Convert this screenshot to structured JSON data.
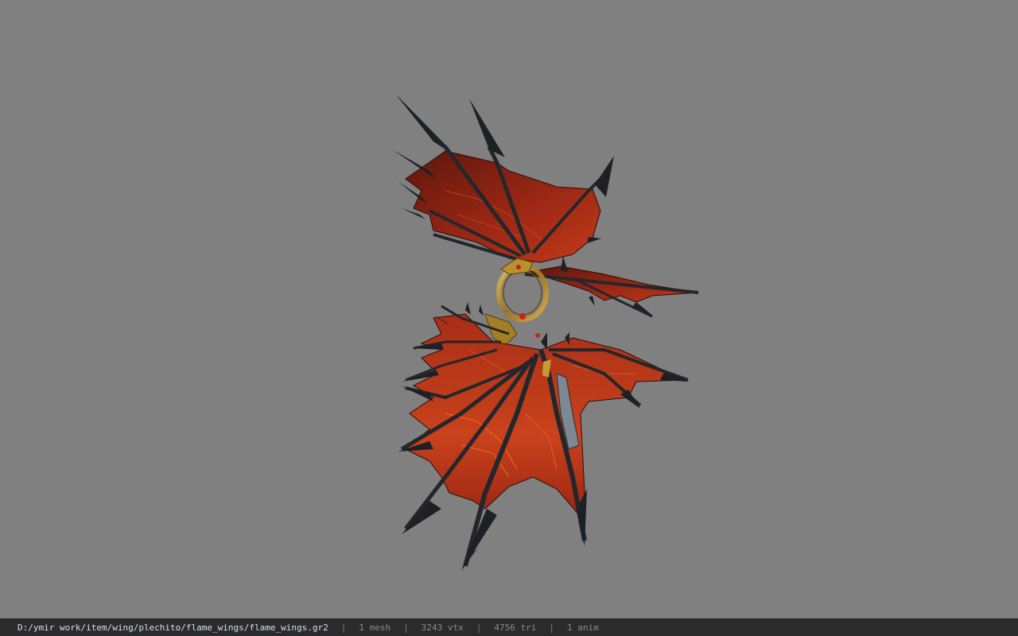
{
  "viewer": {
    "background_color": "#808080",
    "model_name": "flame_wings",
    "model_colors": {
      "membrane": "#8f2213",
      "membrane_highlight": "#c8401c",
      "lava_vein": "#f06a1e",
      "spikes": "#1e2226",
      "gold_ring": "#b8902c"
    }
  },
  "status_bar": {
    "file_path": "D:/ymir work/item/wing/plechito/flame_wings/flame_wings.gr2",
    "separator": "|",
    "mesh_count": "1 mesh",
    "vertex_count": "3243 vtx",
    "triangle_count": "4756 tri",
    "anim_count": "1 anim"
  }
}
